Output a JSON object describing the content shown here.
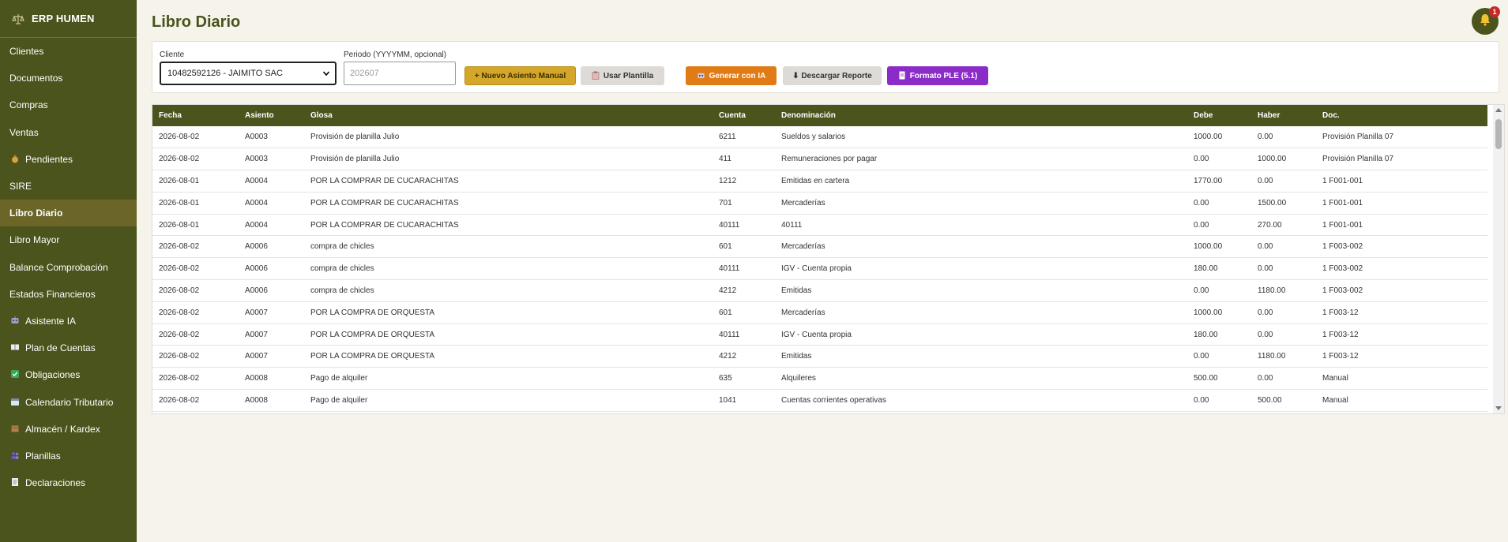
{
  "app": {
    "title": "ERP HUMEN"
  },
  "sidebar": {
    "items": [
      {
        "label": "Clientes",
        "icon": ""
      },
      {
        "label": "Documentos",
        "icon": ""
      },
      {
        "label": "Compras",
        "icon": ""
      },
      {
        "label": "Ventas",
        "icon": ""
      },
      {
        "label": "Pendientes",
        "icon": "money-bag-icon"
      },
      {
        "label": "SIRE",
        "icon": ""
      },
      {
        "label": "Libro Diario",
        "icon": "",
        "active": true
      },
      {
        "label": "Libro Mayor",
        "icon": ""
      },
      {
        "label": "Balance Comprobación",
        "icon": ""
      },
      {
        "label": "Estados Financieros",
        "icon": ""
      },
      {
        "label": "Asistente IA",
        "icon": "robot-icon"
      },
      {
        "label": "Plan de Cuentas",
        "icon": "book-icon"
      },
      {
        "label": "Obligaciones",
        "icon": "checkbox-icon"
      },
      {
        "label": "Calendario Tributario",
        "icon": "calendar-icon"
      },
      {
        "label": "Almacén / Kardex",
        "icon": "box-icon"
      },
      {
        "label": "Planillas",
        "icon": "people-icon"
      },
      {
        "label": "Declaraciones",
        "icon": "document-icon"
      }
    ]
  },
  "header": {
    "title": "Libro Diario",
    "notification_count": "1"
  },
  "filters": {
    "client_label": "Cliente",
    "client_value": "10482592126 - JAIMITO SAC",
    "period_label": "Periodo (YYYYMM, opcional)",
    "period_placeholder": "202607"
  },
  "toolbar": {
    "new_entry": "+ Nuevo Asiento Manual",
    "use_template": "Usar Plantilla",
    "generate_ai": "Generar con IA",
    "download_report": "⬇ Descargar Reporte",
    "ple_format": "Formato PLE (5.1)"
  },
  "table": {
    "headers": [
      "Fecha",
      "Asiento",
      "Glosa",
      "Cuenta",
      "Denominación",
      "Debe",
      "Haber",
      "Doc."
    ],
    "rows": [
      [
        "2026-08-02",
        "A0003",
        "Provisión de planilla Julio",
        "6211",
        "Sueldos y salarios",
        "1000.00",
        "0.00",
        "Provisión Planilla 07"
      ],
      [
        "2026-08-02",
        "A0003",
        "Provisión de planilla Julio",
        "411",
        "Remuneraciones por pagar",
        "0.00",
        "1000.00",
        "Provisión Planilla 07"
      ],
      [
        "2026-08-01",
        "A0004",
        "POR LA COMPRAR DE CUCARACHITAS",
        "1212",
        "Emitidas en cartera",
        "1770.00",
        "0.00",
        "1 F001-001"
      ],
      [
        "2026-08-01",
        "A0004",
        "POR LA COMPRAR DE CUCARACHITAS",
        "701",
        "Mercaderías",
        "0.00",
        "1500.00",
        "1 F001-001"
      ],
      [
        "2026-08-01",
        "A0004",
        "POR LA COMPRAR DE CUCARACHITAS",
        "40111",
        "40111",
        "0.00",
        "270.00",
        "1 F001-001"
      ],
      [
        "2026-08-02",
        "A0006",
        "compra de chicles",
        "601",
        "Mercaderías",
        "1000.00",
        "0.00",
        "1 F003-002"
      ],
      [
        "2026-08-02",
        "A0006",
        "compra de chicles",
        "40111",
        "IGV - Cuenta propia",
        "180.00",
        "0.00",
        "1 F003-002"
      ],
      [
        "2026-08-02",
        "A0006",
        "compra de chicles",
        "4212",
        "Emitidas",
        "0.00",
        "1180.00",
        "1 F003-002"
      ],
      [
        "2026-08-02",
        "A0007",
        "POR LA COMPRA DE ORQUESTA",
        "601",
        "Mercaderías",
        "1000.00",
        "0.00",
        "1 F003-12"
      ],
      [
        "2026-08-02",
        "A0007",
        "POR LA COMPRA DE ORQUESTA",
        "40111",
        "IGV - Cuenta propia",
        "180.00",
        "0.00",
        "1 F003-12"
      ],
      [
        "2026-08-02",
        "A0007",
        "POR LA COMPRA DE ORQUESTA",
        "4212",
        "Emitidas",
        "0.00",
        "1180.00",
        "1 F003-12"
      ],
      [
        "2026-08-02",
        "A0008",
        "Pago de alquiler",
        "635",
        "Alquileres",
        "500.00",
        "0.00",
        "Manual"
      ],
      [
        "2026-08-02",
        "A0008",
        "Pago de alquiler",
        "1041",
        "Cuentas corrientes operativas",
        "0.00",
        "500.00",
        "Manual"
      ]
    ]
  },
  "colors": {
    "sidebar_bg": "#4a541c",
    "accent_gold": "#d4a62a",
    "accent_orange": "#e07b15",
    "accent_purple": "#8b2cc9"
  }
}
